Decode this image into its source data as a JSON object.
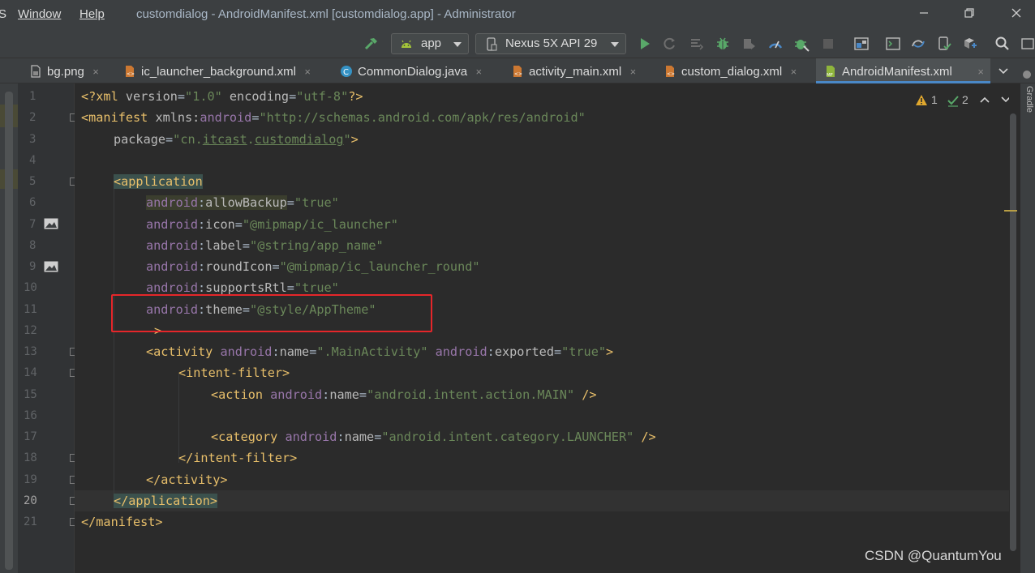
{
  "menu": {
    "partial_left": "S",
    "window": "Window",
    "help": "Help"
  },
  "window_title": "customdialog - AndroidManifest.xml [customdialog.app] - Administrator",
  "toolbar": {
    "run_config": "app",
    "device": "Nexus 5X API 29"
  },
  "tabs": [
    {
      "label": "bg.png",
      "icon": "image-file-icon",
      "active": false
    },
    {
      "label": "ic_launcher_background.xml",
      "icon": "xml-file-icon",
      "active": false
    },
    {
      "label": "CommonDialog.java",
      "icon": "java-class-icon",
      "active": false
    },
    {
      "label": "activity_main.xml",
      "icon": "xml-file-icon",
      "active": false
    },
    {
      "label": "custom_dialog.xml",
      "icon": "xml-file-icon",
      "active": false
    },
    {
      "label": "AndroidManifest.xml",
      "icon": "manifest-file-icon",
      "active": true
    }
  ],
  "tab_close": "×",
  "gutter": {
    "lines": [
      "1",
      "2",
      "3",
      "4",
      "5",
      "6",
      "7",
      "8",
      "9",
      "10",
      "11",
      "12",
      "13",
      "14",
      "15",
      "16",
      "17",
      "18",
      "19",
      "20",
      "21"
    ],
    "current_line": "20"
  },
  "code": {
    "l1": {
      "a": "<?xml ",
      "b": "version",
      "c": "=",
      "d": "\"1.0\"",
      "e": " encoding",
      "f": "=",
      "g": "\"utf-8\"",
      "h": "?>"
    },
    "l2": {
      "a": "<manifest ",
      "b": "xmlns:",
      "c": "android",
      "d": "=",
      "e": "\"http://schemas.android.com/apk/res/android\""
    },
    "l3": {
      "a": "package",
      "b": "=",
      "c": "\"cn.",
      "d": "itcast",
      "e": ".",
      "f": "customdialog",
      "g": "\"",
      "h": ">"
    },
    "l5": {
      "a": "<application"
    },
    "l6": {
      "ns": "android",
      "colon": ":",
      "attr": "allowBackup",
      "eq": "=",
      "val": "\"true\""
    },
    "l7": {
      "ns": "android",
      "colon": ":",
      "attr": "icon",
      "eq": "=",
      "val": "\"@mipmap/ic_launcher\""
    },
    "l8": {
      "ns": "android",
      "colon": ":",
      "attr": "label",
      "eq": "=",
      "val": "\"@string/app_name\""
    },
    "l9": {
      "ns": "android",
      "colon": ":",
      "attr": "roundIcon",
      "eq": "=",
      "val": "\"@mipmap/ic_launcher_round\""
    },
    "l10": {
      "ns": "android",
      "colon": ":",
      "attr": "supportsRtl",
      "eq": "=",
      "val": "\"true\""
    },
    "l11": {
      "ns": "android",
      "colon": ":",
      "attr": "theme",
      "eq": "=",
      "val": "\"@style/AppTheme\""
    },
    "l12": {
      "a": ">"
    },
    "l13": {
      "a": "<activity ",
      "ns1": "android",
      "c1": ":",
      "at1": "name",
      "e1": "=",
      "v1": "\".MainActivity\"",
      "ns2": " android",
      "c2": ":",
      "at2": "exported",
      "e2": "=",
      "v2": "\"true\"",
      "end": ">"
    },
    "l14": {
      "a": "<intent-filter>"
    },
    "l15": {
      "a": "<action ",
      "ns": "android",
      "colon": ":",
      "attr": "name",
      "eq": "=",
      "val": "\"android.intent.action.MAIN\"",
      "end": " />"
    },
    "l17": {
      "a": "<category ",
      "ns": "android",
      "colon": ":",
      "attr": "name",
      "eq": "=",
      "val": "\"android.intent.category.LAUNCHER\"",
      "end": " />"
    },
    "l18": {
      "a": "</intent-filter>"
    },
    "l19": {
      "a": "</activity>"
    },
    "l20": {
      "a": "</application>"
    },
    "l21": {
      "a": "</manifest>"
    }
  },
  "inspections": {
    "warnings": "1",
    "weak_warnings": "2"
  },
  "right_panel": {
    "gradle": "Gradle"
  },
  "watermark": "CSDN @QuantumYou",
  "colors": {
    "accent": "#4a88c7",
    "highlight_box": "#e5262a",
    "tag": "#e8bf6a",
    "namespace": "#9876aa",
    "string": "#6a8759"
  }
}
